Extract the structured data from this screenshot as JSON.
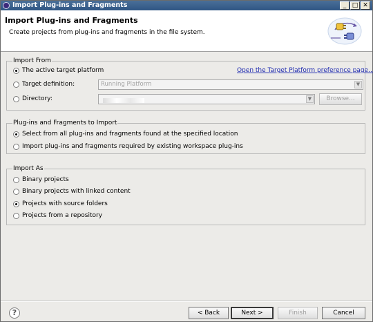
{
  "window": {
    "title": "Import Plug-ins and Fragments",
    "controls": {
      "minimize": "_",
      "maximize": "□",
      "close": "✕"
    }
  },
  "header": {
    "title": "Import Plug-ins and Fragments",
    "description": "Create projects from plug-ins and fragments in the file system.",
    "icon": "plugin-import-banner-icon"
  },
  "import_from": {
    "label": "Import From",
    "active_target": "The active target platform",
    "preference_link": "Open the Target Platform preference page...",
    "target_definition": "Target definition:",
    "target_definition_value": "Running Platform",
    "directory": "Directory:",
    "directory_value": "",
    "browse": "Browse..."
  },
  "plugins_to_import": {
    "label": "Plug-ins and Fragments to Import",
    "option1": "Select from all plug-ins and fragments found at the specified location",
    "option2": "Import plug-ins and fragments required by existing workspace plug-ins"
  },
  "import_as": {
    "label": "Import As",
    "option1": "Binary projects",
    "option2": "Binary projects with linked content",
    "option3": "Projects with source folders",
    "option4": "Projects from a repository"
  },
  "footer": {
    "help": "?",
    "back": "< Back",
    "next": "Next >",
    "finish": "Finish",
    "cancel": "Cancel"
  },
  "colors": {
    "titlebar": "#2f5684",
    "link": "#1f2bb0",
    "dialog_bg": "#ecebe8"
  }
}
